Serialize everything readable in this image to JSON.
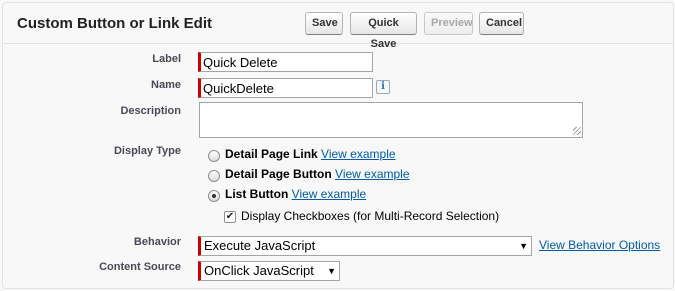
{
  "header": {
    "title": "Custom Button or Link Edit",
    "buttons": {
      "save": "Save",
      "quick_save": "Quick Save",
      "preview": "Preview",
      "cancel": "Cancel"
    }
  },
  "form": {
    "label": {
      "label": "Label",
      "value": "Quick Delete"
    },
    "name": {
      "label": "Name",
      "value": "QuickDelete",
      "info_icon": "i"
    },
    "description": {
      "label": "Description",
      "value": ""
    },
    "display_type": {
      "label": "Display Type",
      "options": [
        {
          "text": "Detail Page Link",
          "link": "View example",
          "checked": false
        },
        {
          "text": "Detail Page Button",
          "link": "View example",
          "checked": false
        },
        {
          "text": "List Button",
          "link": "View example",
          "checked": true
        }
      ],
      "checkbox_label": "Display Checkboxes (for Multi-Record Selection)",
      "checkbox_checked": true,
      "checkbox_glyph": "✔"
    },
    "behavior": {
      "label": "Behavior",
      "value": "Execute JavaScript",
      "link": "View Behavior Options"
    },
    "content_source": {
      "label": "Content Source",
      "value": "OnClick JavaScript"
    },
    "dropdown_arrow": "▼"
  },
  "colors": {
    "required": "#cc0000",
    "link": "#015ba7"
  }
}
